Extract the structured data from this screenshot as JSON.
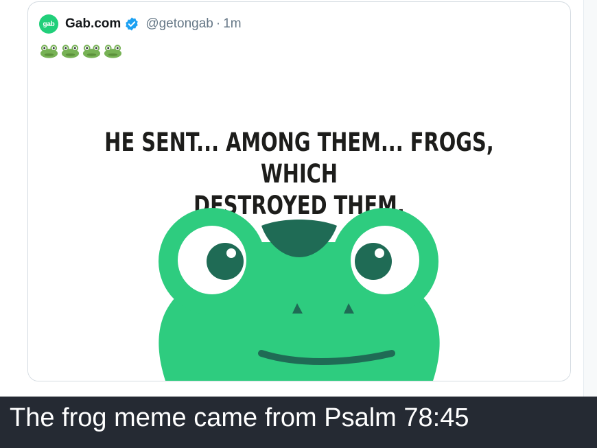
{
  "tweet": {
    "logo_text": "gab",
    "display_name": "Gab.com",
    "handle": "@getongab",
    "separator": "·",
    "time": "1m",
    "verified_icon": "verified-badge-icon",
    "emojis": [
      "frog-emoji",
      "frog-emoji",
      "frog-emoji",
      "frog-emoji"
    ],
    "image": {
      "line1": "HE SENT... AMONG THEM... FROGS, WHICH",
      "line2": "DESTROYED THEM."
    }
  },
  "caption": {
    "text": "The frog meme came from Psalm 78:45"
  },
  "colors": {
    "frog_green": "#2ecc7f",
    "frog_dark": "#1f6b55",
    "verified_blue": "#1da1f2",
    "caption_bg": "#252a33"
  }
}
